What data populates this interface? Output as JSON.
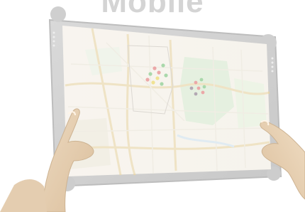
{
  "image": {
    "title": "Mobile",
    "description_icons": [
      "tablet-device",
      "hands",
      "map"
    ]
  },
  "map": {
    "marker_colors": {
      "green": "#7cc47e",
      "yellow": "#e8d35a",
      "red": "#e07a7a",
      "dark": "#8a7a8a"
    }
  }
}
